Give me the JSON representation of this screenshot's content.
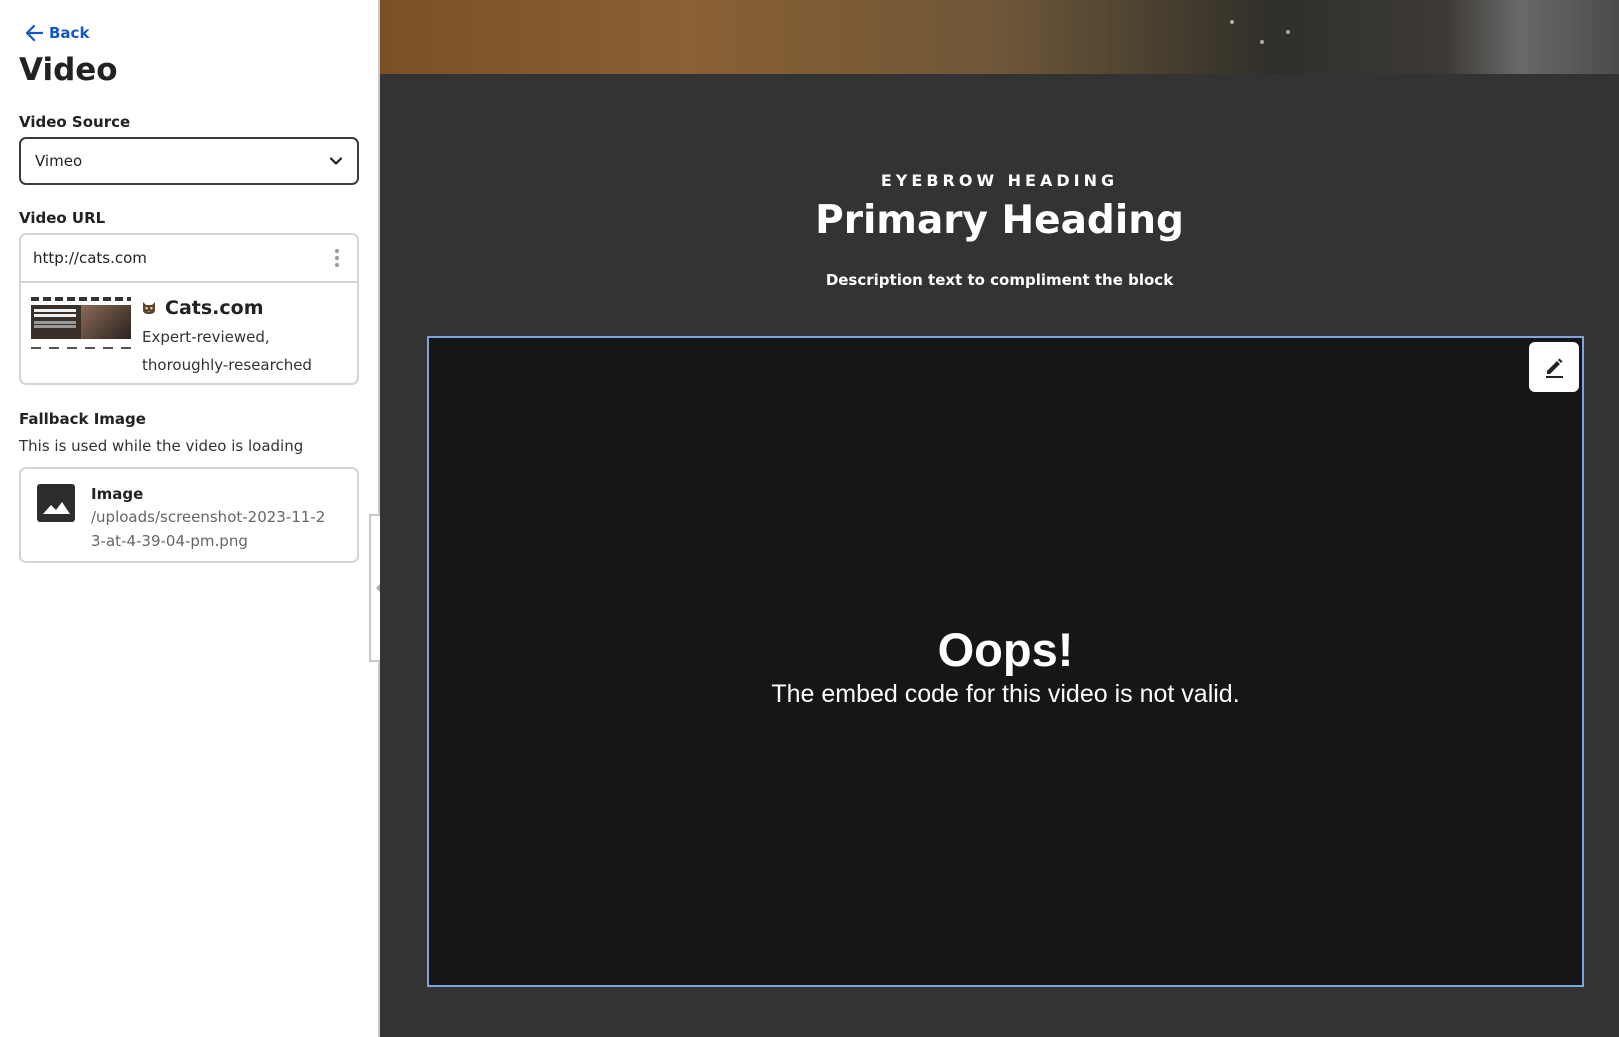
{
  "sidebar": {
    "back_label": "Back",
    "title": "Video",
    "video_source": {
      "label": "Video Source",
      "selected": "Vimeo"
    },
    "video_url": {
      "label": "Video URL",
      "value": "http://cats.com",
      "preview": {
        "title": "Cats.com",
        "description": "Expert-reviewed, thoroughly-researched"
      }
    },
    "fallback_image": {
      "label": "Fallback Image",
      "help": "This is used while the video is loading",
      "title": "Image",
      "path": "/uploads/screenshot-2023-11-23-at-4-39-04-pm.png"
    }
  },
  "canvas": {
    "eyebrow": "EYEBROW HEADING",
    "primary_heading": "Primary Heading",
    "description": "Description text to compliment the block",
    "video_error": {
      "title": "Oops!",
      "message": "The embed code for this video is not valid."
    }
  },
  "colors": {
    "link": "#1456c6",
    "canvas_bg": "#333333",
    "video_bg": "#161616",
    "selection_outline": "#7ea3dd"
  },
  "icons": [
    "arrow-left-icon",
    "chevron-down-icon",
    "kebab-menu-icon",
    "cat-favicon-icon",
    "image-icon",
    "pencil-icon",
    "collapse-arrow-icon"
  ]
}
